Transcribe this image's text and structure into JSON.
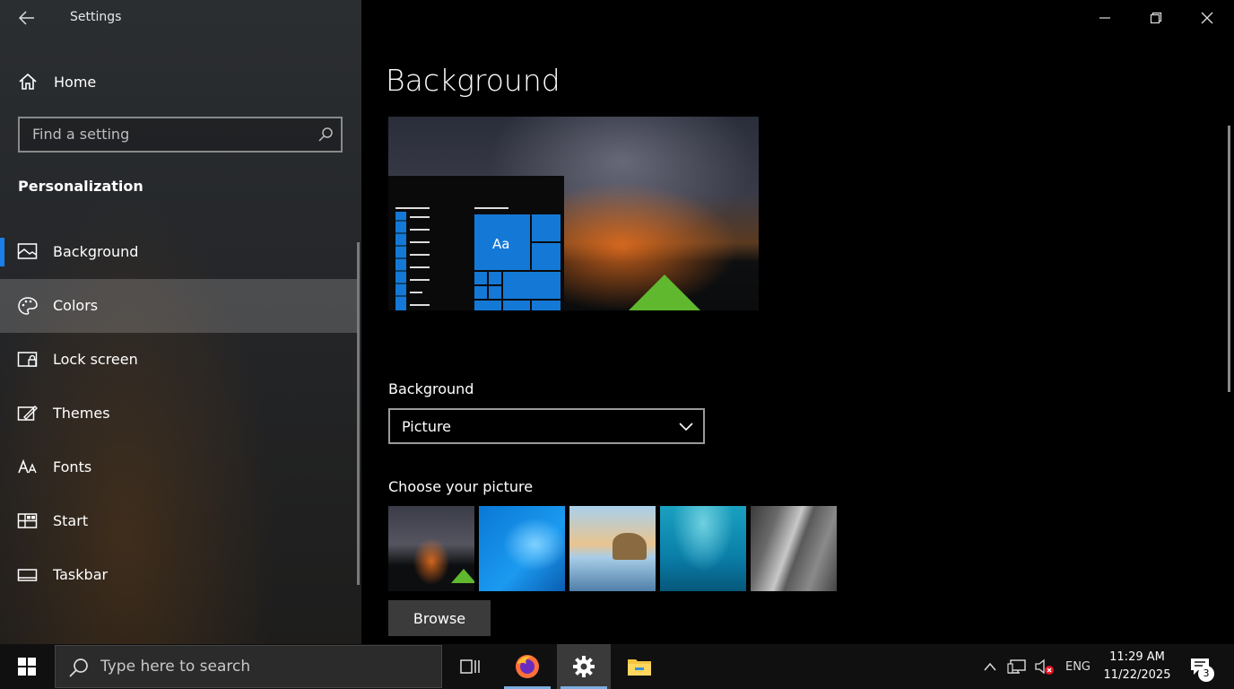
{
  "window": {
    "title": "Settings"
  },
  "sidebar": {
    "home_label": "Home",
    "search_placeholder": "Find a setting",
    "section_title": "Personalization",
    "items": [
      {
        "label": "Background",
        "icon": "picture-icon"
      },
      {
        "label": "Colors",
        "icon": "palette-icon"
      },
      {
        "label": "Lock screen",
        "icon": "lock-screen-icon"
      },
      {
        "label": "Themes",
        "icon": "themes-icon"
      },
      {
        "label": "Fonts",
        "icon": "fonts-icon"
      },
      {
        "label": "Start",
        "icon": "start-icon"
      },
      {
        "label": "Taskbar",
        "icon": "taskbar-icon"
      }
    ],
    "active_item": "Background",
    "hovered_item": "Colors"
  },
  "main": {
    "page_title": "Background",
    "preview_tile_text": "Aa",
    "background_label": "Background",
    "background_value": "Picture",
    "choose_label": "Choose your picture",
    "browse_label": "Browse"
  },
  "taskbar": {
    "search_placeholder": "Type here to search",
    "language": "ENG",
    "time": "11:29 AM",
    "date": "11/22/2025",
    "notification_count": "3"
  },
  "colors": {
    "accent": "#1a7fe6",
    "tile_blue": "#1479d6"
  }
}
